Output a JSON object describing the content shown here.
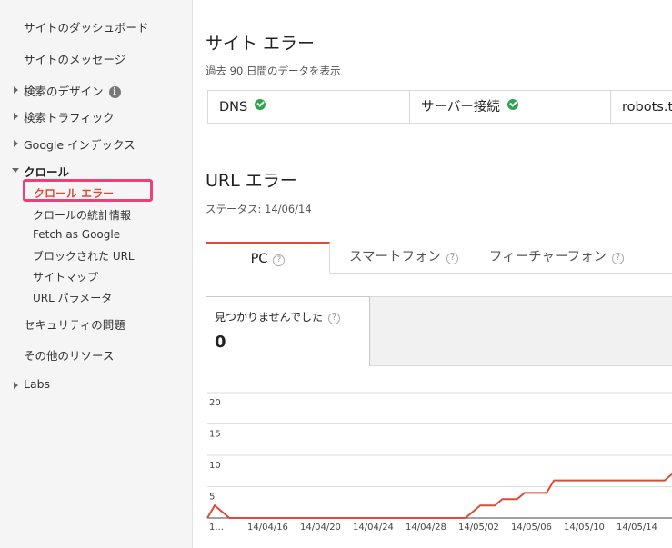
{
  "sidebar": {
    "items": [
      {
        "label": "サイトのダッシュボード"
      },
      {
        "label": "サイトのメッセージ"
      },
      {
        "label": "検索のデザイン",
        "info": "i"
      },
      {
        "label": "検索トラフィック"
      },
      {
        "label": "Google インデックス"
      },
      {
        "label": "クロール"
      },
      {
        "label": "クロール エラー"
      },
      {
        "label": "クロールの統計情報"
      },
      {
        "label": "Fetch as Google"
      },
      {
        "label": "ブロックされた URL"
      },
      {
        "label": "サイトマップ"
      },
      {
        "label": "URL パラメータ"
      },
      {
        "label": "セキュリティの問題"
      },
      {
        "label": "その他のリソース"
      },
      {
        "label": "Labs"
      }
    ]
  },
  "site_errors": {
    "title": "サイト エラー",
    "subtitle": "過去 90 日間のデータを表示",
    "cells": [
      {
        "label": "DNS"
      },
      {
        "label": "サーバー接続"
      },
      {
        "label": "robots.txt"
      }
    ]
  },
  "url_errors": {
    "title": "URL エラー",
    "status": "ステータス: 14/06/14",
    "tabs": [
      {
        "label": "PC"
      },
      {
        "label": "スマートフォン"
      },
      {
        "label": "フィーチャーフォン"
      }
    ],
    "metric": {
      "label": "見つかりませんでした",
      "value": "0"
    }
  },
  "colors": {
    "accent": "#dd4b39",
    "highlight": "#ee3f7a",
    "ok": "#2da44e"
  },
  "chart_data": {
    "type": "line",
    "ylim": [
      0,
      20
    ],
    "yticks": [
      5,
      10,
      15,
      20
    ],
    "xtick_labels": [
      "1...",
      "14/04/16",
      "14/04/20",
      "14/04/24",
      "14/04/28",
      "14/05/02",
      "14/05/06",
      "14/05/10",
      "14/05/14"
    ],
    "series": [
      {
        "values": [
          0,
          2,
          1,
          0,
          0,
          0,
          0,
          0,
          0,
          0,
          0,
          0,
          0,
          0,
          0,
          0,
          0,
          0,
          0,
          0,
          0,
          0,
          0,
          0,
          0,
          0,
          0,
          0,
          0,
          0,
          0,
          0,
          0,
          0,
          0,
          0,
          1,
          2,
          2,
          2,
          3,
          3,
          3,
          4,
          4,
          4,
          4,
          6,
          6,
          6,
          6,
          6,
          6,
          6,
          6,
          6,
          6,
          6,
          6,
          6,
          6,
          6,
          6,
          7
        ]
      }
    ]
  }
}
